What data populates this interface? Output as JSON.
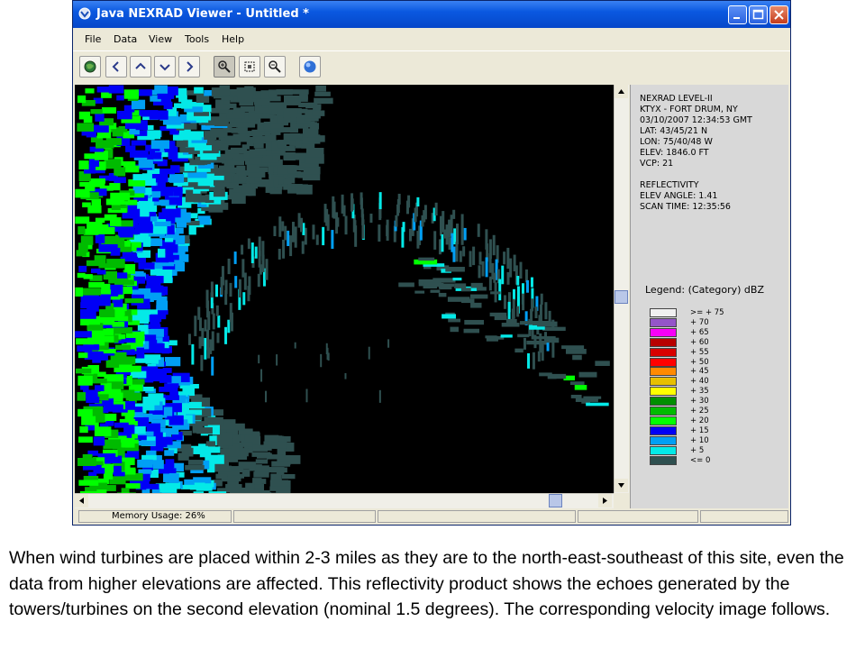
{
  "window": {
    "title": "Java NEXRAD Viewer - Untitled *"
  },
  "menu": [
    "File",
    "Data",
    "View",
    "Tools",
    "Help"
  ],
  "toolbar_icons": [
    "globe-icon",
    "chevron-left-icon",
    "chevron-up-icon",
    "chevron-down-icon",
    "chevron-right-icon",
    "zoom-in-icon",
    "zoom-box-icon",
    "zoom-out-icon",
    "earth-icon"
  ],
  "info": {
    "lines": [
      "NEXRAD LEVEL-II",
      "KTYX - FORT DRUM, NY",
      "03/10/2007 12:34:53 GMT",
      "LAT: 43/45/21 N",
      "LON: 75/40/48 W",
      "ELEV: 1846.0 FT",
      "VCP: 21",
      "",
      "REFLECTIVITY",
      "ELEV ANGLE: 1.41",
      "SCAN TIME: 12:35:56"
    ]
  },
  "legend": {
    "title": "Legend: (Category) dBZ",
    "entries": [
      {
        "label": ">= + 75",
        "color": "#f0f0f0"
      },
      {
        "label": "+ 70",
        "color": "#9455c9"
      },
      {
        "label": "+ 65",
        "color": "#f700f7"
      },
      {
        "label": "+ 60",
        "color": "#b80000"
      },
      {
        "label": "+ 55",
        "color": "#d80000"
      },
      {
        "label": "+ 50",
        "color": "#ff0000"
      },
      {
        "label": "+ 45",
        "color": "#ff8a00"
      },
      {
        "label": "+ 40",
        "color": "#e7c000"
      },
      {
        "label": "+ 35",
        "color": "#ffff00"
      },
      {
        "label": "+ 30",
        "color": "#008f00"
      },
      {
        "label": "+ 25",
        "color": "#00bb00"
      },
      {
        "label": "+ 20",
        "color": "#00ff00"
      },
      {
        "label": "+ 15",
        "color": "#0000f6"
      },
      {
        "label": "+ 10",
        "color": "#019ff4"
      },
      {
        "label": "+ 5",
        "color": "#04e9e7"
      },
      {
        "label": "<= 0",
        "color": "#2f5050"
      }
    ]
  },
  "status": {
    "memory": "Memory Usage: 26%"
  },
  "caption": "When wind turbines are placed within 2-3 miles as they are to the north-east-southeast of this site, even the data from higher elevations are affected.  This reflectivity product shows the echoes generated by the towers/turbines on the second elevation (nominal 1.5 degrees).  The corresponding velocity image follows."
}
